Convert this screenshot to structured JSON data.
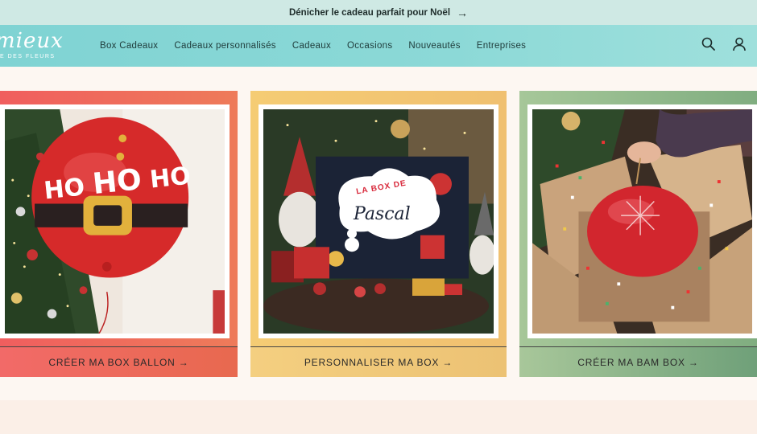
{
  "announcement": {
    "text": "Dénicher le cadeau parfait pour Noël",
    "arrow": "→"
  },
  "logo": {
    "main": "mieux",
    "sub": "E DES FLEURS"
  },
  "nav": {
    "items": [
      "Box Cadeaux",
      "Cadeaux personnalisés",
      "Cadeaux",
      "Occasions",
      "Nouveautés",
      "Entreprises"
    ],
    "icons": [
      "search-icon",
      "user-icon"
    ]
  },
  "cards": [
    {
      "cta": "CRÉER MA BOX BALLON →",
      "balloon_text": [
        "HO",
        "HO",
        "HO"
      ],
      "accent": "#f05e5e"
    },
    {
      "cta": "PERSONNALISER MA BOX →",
      "box_title": "LA BOX DE",
      "box_name": "Pascal",
      "accent": "#f5cc74"
    },
    {
      "cta": "CRÉER MA BAM BOX →",
      "accent": "#80ad80"
    }
  ],
  "headline": "",
  "colors": {
    "announce_bg": "#cfe9e4",
    "nav_bg": "#8cd9d7",
    "page_bg": "#fdf7f2"
  }
}
